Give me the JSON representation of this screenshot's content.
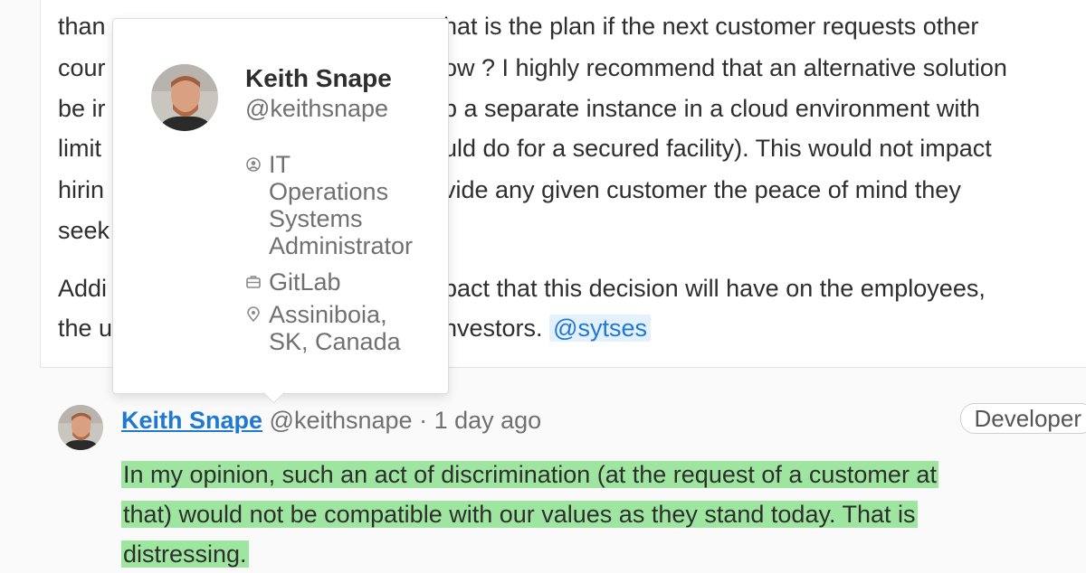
{
  "previous_comment": {
    "left_lines": [
      "than",
      "cour",
      "be ir",
      "limit",
      "hirin",
      "seek",
      "Addi",
      "the u"
    ],
    "right_lines": [
      "hat is the plan if the next customer requests other",
      "ow ? I highly recommend that an alternative solution",
      "p a separate instance in a cloud environment with",
      "uld do for a secured facility). This would not impact",
      "vide any given customer the peace of mind they",
      "",
      "pact that this decision will have on the employees,",
      "nvestors."
    ],
    "mention": "@sytses"
  },
  "popover": {
    "name": "Keith Snape",
    "handle": "@keithsnape",
    "role": "IT\nOperations\nSystems\nAdministrator",
    "organization": "GitLab",
    "location": "Assiniboia,\nSK, Canada",
    "icons": [
      "avatar-photo",
      "role-icon",
      "briefcase-icon",
      "location-pin-icon"
    ]
  },
  "comment": {
    "author_name": "Keith Snape",
    "author_handle": "@keithsnape",
    "separator": " · ",
    "time_ago": "1 day ago",
    "role_badge": "Developer",
    "body_lines": [
      "In my opinion, such an act of discrimination (at the request of a customer at",
      "that) would not be compatible with our values as they stand today. That is",
      "distressing."
    ],
    "highlight_color": "#9ee6a0"
  },
  "colors": {
    "link": "#1f78d1",
    "text": "#2e2e2e",
    "muted": "#707070",
    "mention_bg": "#e4f0fb"
  }
}
